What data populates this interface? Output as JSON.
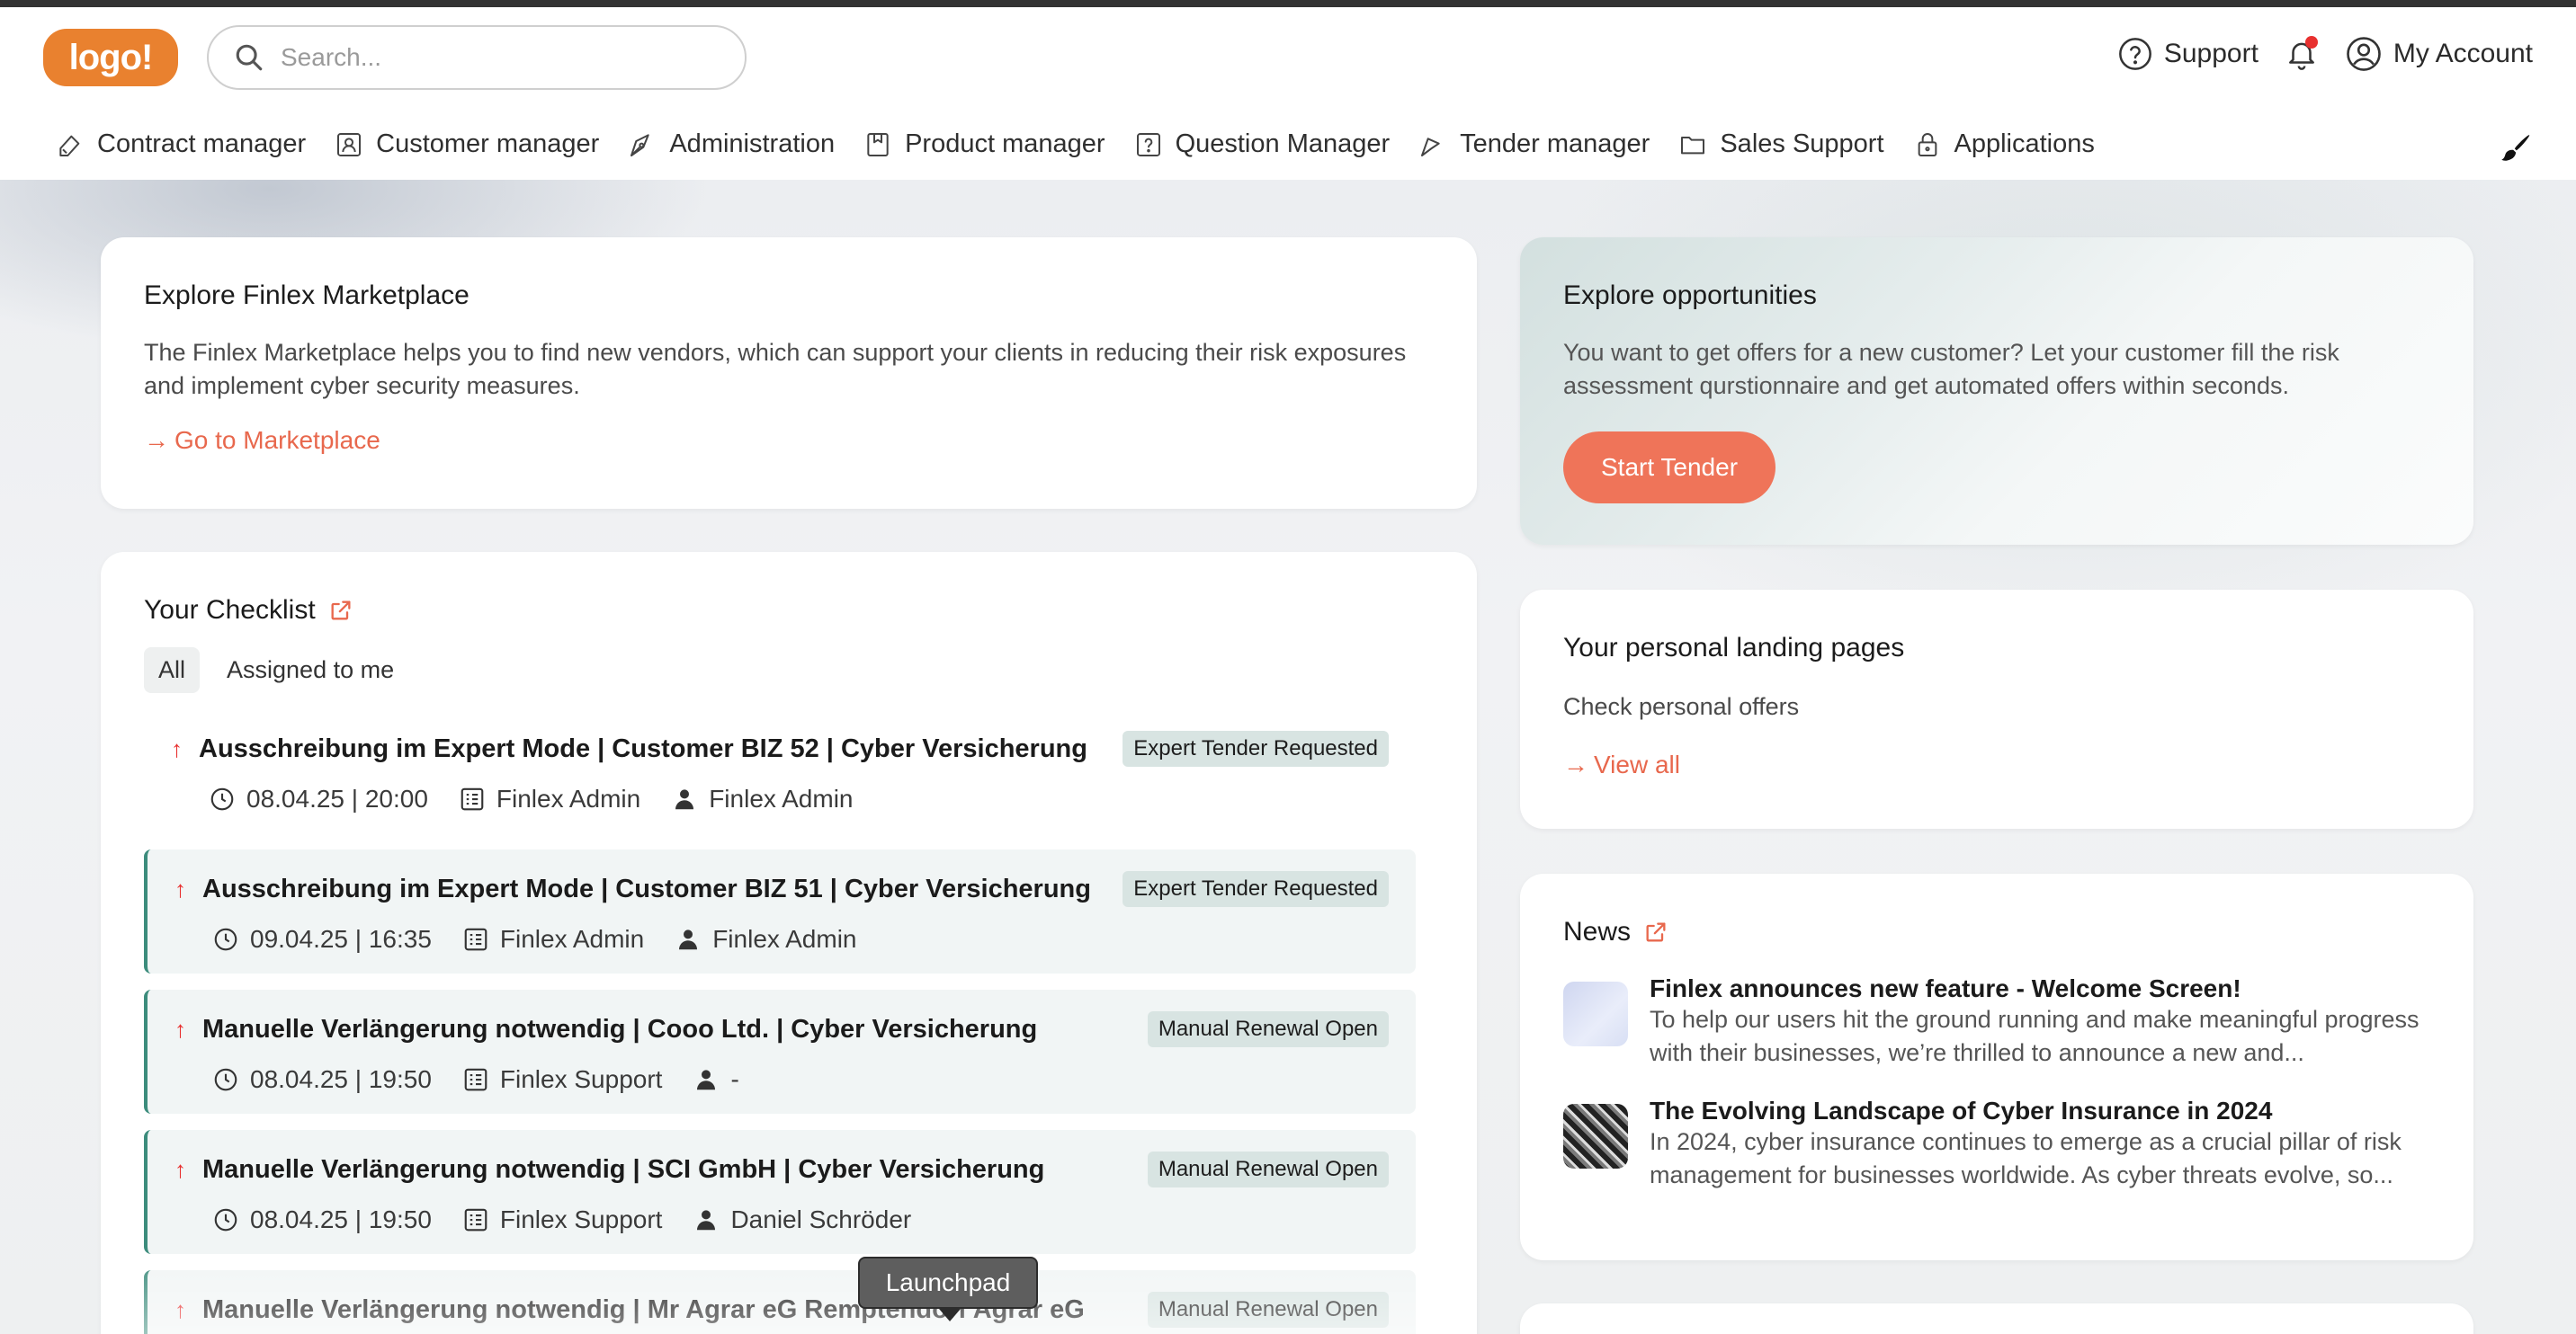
{
  "header": {
    "logo_text": "logo!",
    "search_placeholder": "Search...",
    "support_label": "Support",
    "account_label": "My Account",
    "brand_color": "#e9812f"
  },
  "nav": {
    "items": [
      {
        "label": "Contract manager",
        "icon": "contract-icon"
      },
      {
        "label": "Customer manager",
        "icon": "customer-icon"
      },
      {
        "label": "Administration",
        "icon": "administration-icon"
      },
      {
        "label": "Product manager",
        "icon": "product-icon"
      },
      {
        "label": "Question Manager",
        "icon": "question-icon"
      },
      {
        "label": "Tender manager",
        "icon": "tender-icon"
      },
      {
        "label": "Sales Support",
        "icon": "folder-icon"
      },
      {
        "label": "Applications",
        "icon": "lock-icon"
      }
    ]
  },
  "marketplace": {
    "title": "Explore Finlex Marketplace",
    "text": "The Finlex Marketplace helps you to find new vendors, which can support your clients in reducing their risk exposures and implement cyber security measures.",
    "link": "Go to Marketplace"
  },
  "opportunities": {
    "title": "Explore opportunities",
    "text": "You want to get offers for a new customer? Let your customer fill the risk assessment qurstionnaire and get automated offers within seconds.",
    "button": "Start Tender"
  },
  "landing": {
    "title": "Your personal landing pages",
    "text": "Check personal offers",
    "link": "View all"
  },
  "news": {
    "title": "News",
    "items": [
      {
        "title": "Finlex announces new feature - Welcome Screen!",
        "text": "To help our users hit the ground running and make meaningful progress with their businesses, we’re thrilled to announce a new and..."
      },
      {
        "title": "The Evolving Landscape of Cyber Insurance in 2024",
        "text": "In 2024, cyber insurance continues to emerge as a crucial pillar of risk management for businesses worldwide. As cyber threats evolve, so..."
      }
    ]
  },
  "checklist": {
    "title": "Your Checklist",
    "filters": [
      "All",
      "Assigned to me"
    ],
    "tasks": [
      {
        "title": "Ausschreibung im Expert Mode | Customer BIZ 52 | Cyber Versicherung",
        "badge": "Expert Tender Requested",
        "date": "08.04.25 | 20:00",
        "creator": "Finlex Admin",
        "assignee": "Finlex Admin"
      },
      {
        "title": "Ausschreibung im Expert Mode | Customer BIZ 51 | Cyber Versicherung",
        "badge": "Expert Tender Requested",
        "date": "09.04.25 | 16:35",
        "creator": "Finlex Admin",
        "assignee": "Finlex Admin"
      },
      {
        "title": "Manuelle Verlängerung notwendig | Cooo Ltd. | Cyber Versicherung",
        "badge": "Manual Renewal Open",
        "date": "08.04.25 | 19:50",
        "creator": "Finlex Support",
        "assignee": "-"
      },
      {
        "title": "Manuelle Verlängerung notwendig | SCI GmbH | Cyber Versicherung",
        "badge": "Manual Renewal Open",
        "date": "08.04.25 | 19:50",
        "creator": "Finlex Support",
        "assignee": "Daniel Schröder"
      },
      {
        "title": "Manuelle Verlängerung notwendig | Mr Agrar eG Remptendorf Agrar eG",
        "badge": "Manual Renewal Open",
        "date": "",
        "creator": "",
        "assignee": ""
      }
    ]
  },
  "tooltip": {
    "label": "Launchpad"
  },
  "colors": {
    "accent": "#ef7459",
    "priority": "#e8302f",
    "teal_border": "#3c8c7c",
    "badge_bg": "#d8e4e2"
  }
}
